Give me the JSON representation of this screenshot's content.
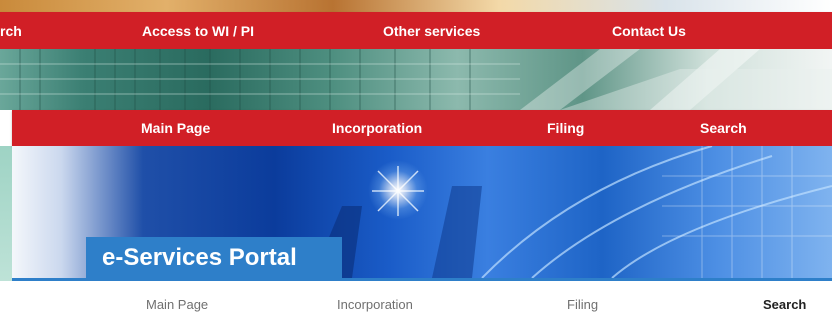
{
  "top_nav": {
    "items": [
      "rch",
      "Access to WI / PI",
      "Other services",
      "Contact Us"
    ]
  },
  "mid_nav": {
    "items": [
      "Main Page",
      "Incorporation",
      "Filing",
      "Search"
    ]
  },
  "portal": {
    "title": "e-Services Portal"
  },
  "bottom_nav": {
    "items": [
      "Main Page",
      "Incorporation",
      "Filing",
      "Search"
    ],
    "active": "Search"
  },
  "colors": {
    "nav_red": "#d11f26",
    "portal_blue": "#2e7fc9",
    "nav_text_gray": "#707070"
  }
}
